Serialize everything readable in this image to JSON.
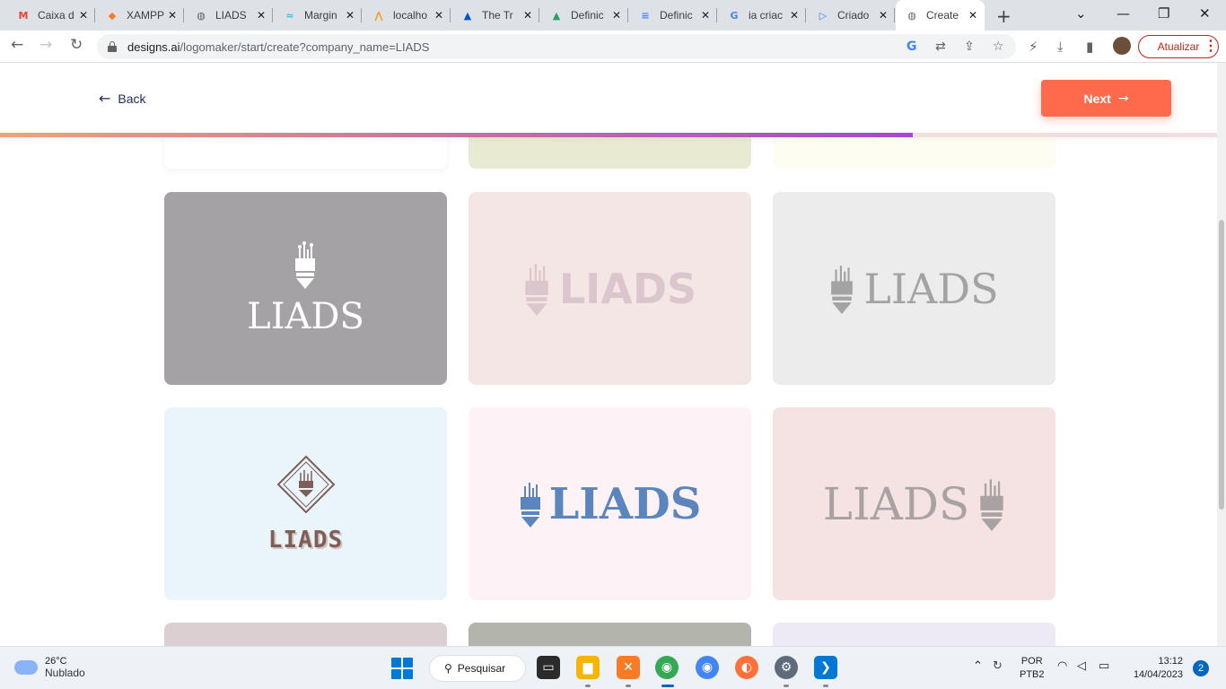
{
  "browser": {
    "tabs": [
      {
        "title": "Caixa d",
        "icon": "gmail-icon",
        "glyph": "M",
        "color": "#ea4335"
      },
      {
        "title": "XAMPP",
        "icon": "xampp-icon",
        "glyph": "◆",
        "color": "#fb7a24"
      },
      {
        "title": "LIADS",
        "icon": "globe-icon",
        "glyph": "◍",
        "color": "#5f6368"
      },
      {
        "title": "Margin",
        "icon": "tailwind-icon",
        "glyph": "≈",
        "color": "#38bdf8"
      },
      {
        "title": "localho",
        "icon": "phpmyadmin-icon",
        "glyph": "⋀",
        "color": "#f89c0e"
      },
      {
        "title": "The Tr",
        "icon": "atlassian-icon",
        "glyph": "▲",
        "color": "#0052cc"
      },
      {
        "title": "Definic",
        "icon": "google-drive-icon",
        "glyph": "▲",
        "color": "#1fa463"
      },
      {
        "title": "Definic",
        "icon": "google-docs-icon",
        "glyph": "≡",
        "color": "#4285f4"
      },
      {
        "title": "ia criac",
        "icon": "google-icon",
        "glyph": "G",
        "color": "#4285f4"
      },
      {
        "title": "Criado",
        "icon": "play-icon",
        "glyph": "▷",
        "color": "#4a7cf6"
      },
      {
        "title": "Create",
        "icon": "globe-icon",
        "glyph": "◍",
        "color": "#5f6368"
      }
    ],
    "url_host": "designs.ai",
    "url_path": "/logomaker/start/create?company_name=LIADS",
    "update_label": "Atualizar"
  },
  "page": {
    "back_label": "Back",
    "next_label": "Next",
    "progress_percent": 75,
    "logos": [
      {
        "text": "LIADS",
        "bg": "#a5a2a6",
        "color": "#ffffff",
        "layout": "icon-top"
      },
      {
        "text": "LIADS",
        "bg": "#f5e6e6",
        "color": "#dcc6ce",
        "layout": "icon-left-bold"
      },
      {
        "text": "LIADS",
        "bg": "#ebeceb",
        "color": "#a3a3a3",
        "layout": "icon-left"
      },
      {
        "text": "LIADS",
        "bg": "#e9f5fa",
        "color": "#7e5e58",
        "layout": "emblem"
      },
      {
        "text": "LIADS",
        "bg": "#fdf2f5",
        "color": "#5b86bd",
        "layout": "icon-left-blue"
      },
      {
        "text": "LIADS",
        "bg": "#f5e3e4",
        "color": "#a8a2a2",
        "layout": "icon-right"
      }
    ]
  },
  "taskbar": {
    "temperature": "26°C",
    "weather": "Nublado",
    "search_label": "Pesquisar",
    "lang_top": "POR",
    "lang_bottom": "PTB2",
    "time": "13:12",
    "date": "14/04/2023",
    "notifications": "2"
  }
}
